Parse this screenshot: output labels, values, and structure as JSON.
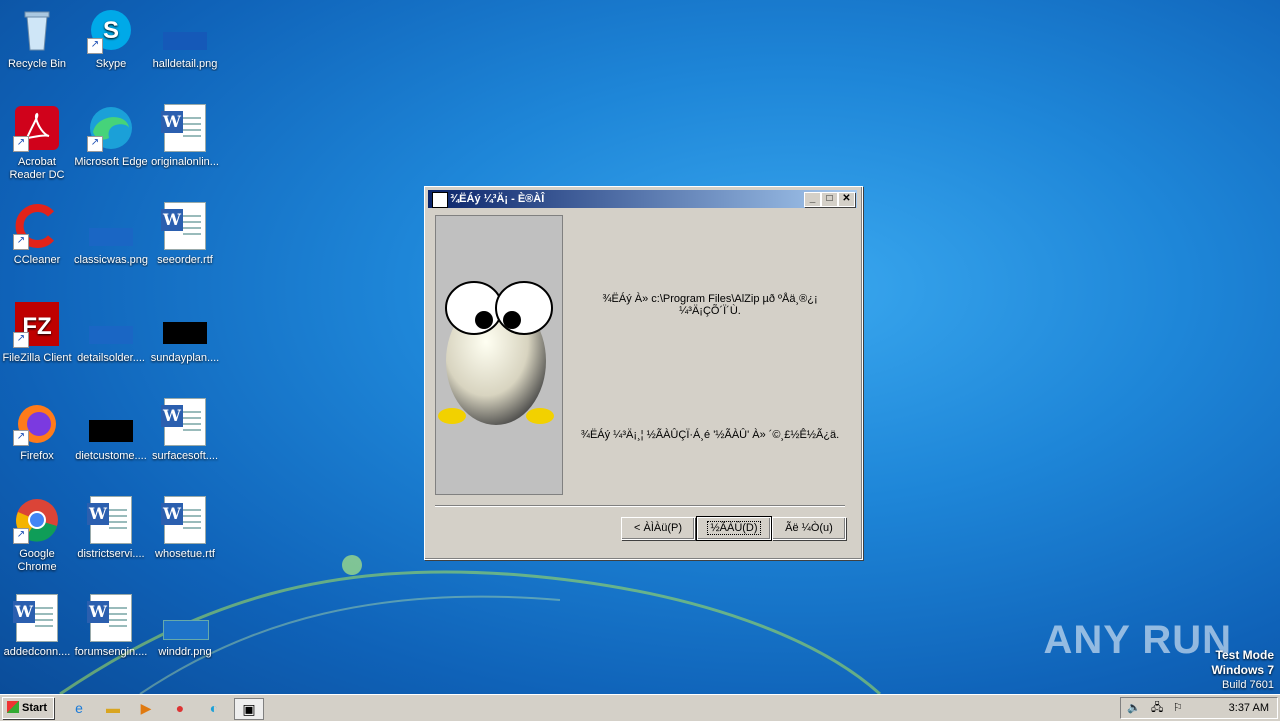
{
  "desktop": {
    "icons": [
      {
        "label": "Recycle Bin"
      },
      {
        "label": "Skype"
      },
      {
        "label": "halldetail.png"
      },
      {
        "label": "Acrobat Reader DC"
      },
      {
        "label": "Microsoft Edge"
      },
      {
        "label": "originalonlin..."
      },
      {
        "label": "CCleaner"
      },
      {
        "label": "classicwas.png"
      },
      {
        "label": "seeorder.rtf"
      },
      {
        "label": "FileZilla Client"
      },
      {
        "label": "detailsolder...."
      },
      {
        "label": "sundayplan...."
      },
      {
        "label": "Firefox"
      },
      {
        "label": "dietcustome...."
      },
      {
        "label": "surfacesoft...."
      },
      {
        "label": "Google Chrome"
      },
      {
        "label": "districtservi...."
      },
      {
        "label": "whosetue.rtf"
      },
      {
        "label": "addedconn...."
      },
      {
        "label": "forumsengin...."
      },
      {
        "label": "winddr.png"
      }
    ]
  },
  "dialog": {
    "title": "¾ËÁý ¼³Ä¡ - È®ÀÎ",
    "message_line1": "¾ËÁý À» c:\\Program Files\\AlZip µð ºÅä¸®¿¡",
    "message_line2": "¼³Ä¡ÇÕ´Ï´Ù.",
    "message_line3": "¾ËÁý ¼³Ä¡¸¦ ½ÃÀÛÇÏ·Á¸é '½ÃÀÛ' À» ´©¸£½Ê½Ã¿ä.",
    "minimize_glyph": "_",
    "maximize_glyph": "□",
    "close_glyph": "✕",
    "buttons": {
      "back": "< ÀÌÀü(P)",
      "start": "½ÃÀÛ(D)",
      "cancel": "Ãë ¼Ò(u)"
    }
  },
  "taskbar": {
    "start_label": "Start",
    "clock": "3:37 AM"
  },
  "watermark": {
    "text": "ANY RUN"
  },
  "testmode": {
    "line1": "Test Mode",
    "line2": "Windows 7",
    "line3": "Build 7601"
  }
}
